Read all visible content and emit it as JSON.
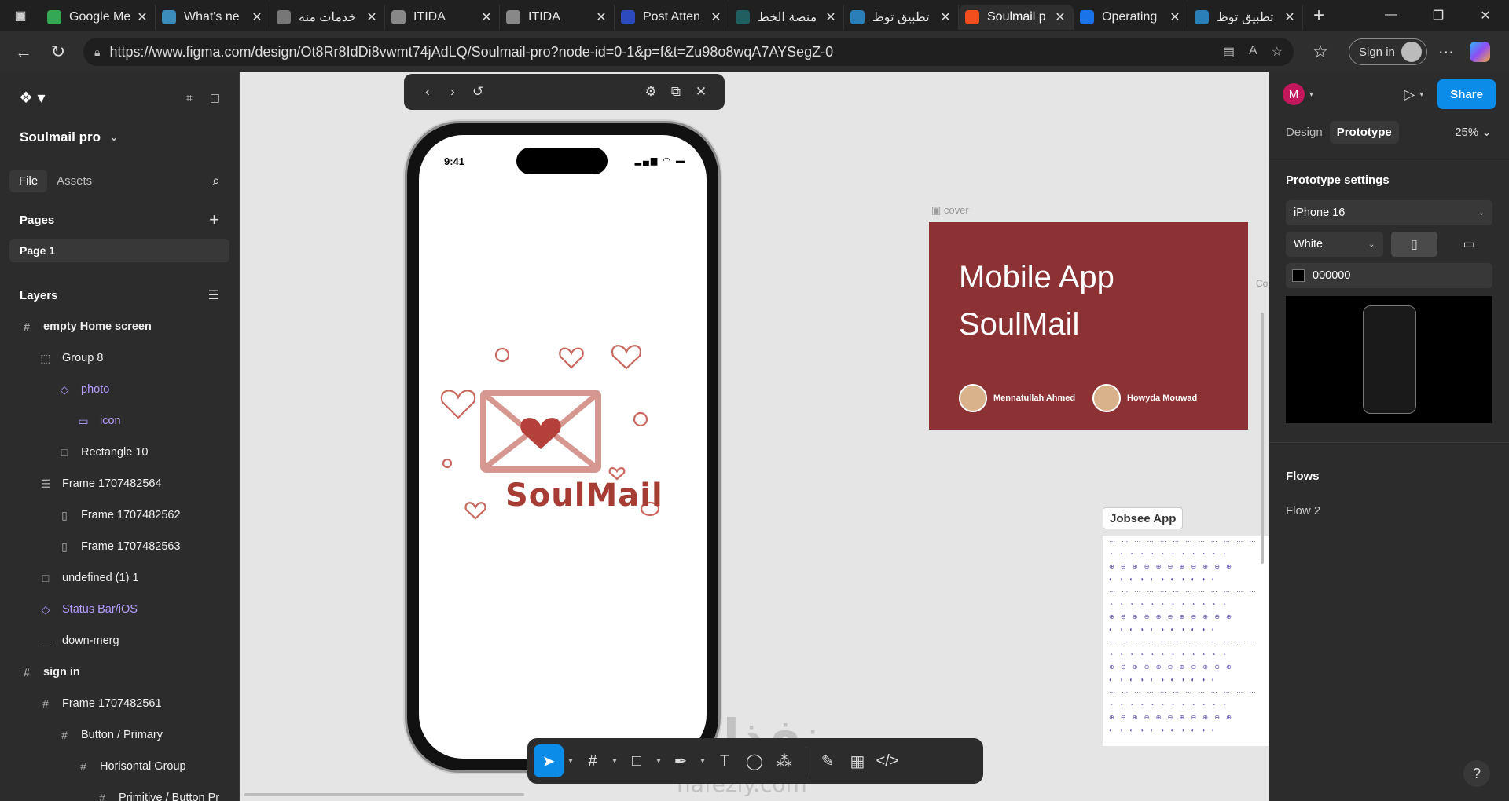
{
  "browser": {
    "tabs": [
      {
        "title": "Google Me",
        "color": "#34a853",
        "active": false
      },
      {
        "title": "What's ne",
        "color": "#3c8dbc",
        "active": false
      },
      {
        "title": "خدمات منه",
        "color": "#777777",
        "active": false
      },
      {
        "title": "ITIDA",
        "color": "#888888",
        "active": false
      },
      {
        "title": "ITIDA",
        "color": "#888888",
        "active": false
      },
      {
        "title": "Post Atten",
        "color": "#2d4bbf",
        "active": false
      },
      {
        "title": "منصة الخط",
        "color": "#1f5f5f",
        "active": false
      },
      {
        "title": "تطبيق توظ",
        "color": "#2a7fb8",
        "active": false
      },
      {
        "title": "Soulmail p",
        "color": "#f24e1e",
        "active": true
      },
      {
        "title": "Operating",
        "color": "#1a73e8",
        "active": false
      },
      {
        "title": "تطبيق توظ",
        "color": "#2a7fb8",
        "active": false
      }
    ],
    "url": "https://www.figma.com/design/Ot8Rr8IdDi8vwmt74jAdLQ/Soulmail-pro?node-id=0-1&p=f&t=Zu98o8wqA7AYSegZ-0",
    "signin_label": "Sign in"
  },
  "left_panel": {
    "project_name": "Soulmail pro",
    "tabs": {
      "file": "File",
      "assets": "Assets"
    },
    "pages_title": "Pages",
    "page1": "Page 1",
    "layers_title": "Layers",
    "layers": [
      {
        "name": "empty Home screen",
        "indent": 0,
        "icon": "#",
        "bold": true,
        "component": false
      },
      {
        "name": "Group 8",
        "indent": 1,
        "icon": "⬚",
        "bold": false,
        "component": false
      },
      {
        "name": "photo",
        "indent": 2,
        "icon": "◇",
        "bold": false,
        "component": true
      },
      {
        "name": "icon",
        "indent": 3,
        "icon": "▭",
        "bold": false,
        "component": true
      },
      {
        "name": "Rectangle 10",
        "indent": 2,
        "icon": "□",
        "bold": false,
        "component": false
      },
      {
        "name": "Frame 1707482564",
        "indent": 1,
        "icon": "☰",
        "bold": false,
        "component": false
      },
      {
        "name": "Frame 1707482562",
        "indent": 2,
        "icon": "▯",
        "bold": false,
        "component": false
      },
      {
        "name": "Frame 1707482563",
        "indent": 2,
        "icon": "▯",
        "bold": false,
        "component": false
      },
      {
        "name": "undefined (1) 1",
        "indent": 1,
        "icon": "□",
        "bold": false,
        "component": false
      },
      {
        "name": "Status Bar/iOS",
        "indent": 1,
        "icon": "◇",
        "bold": false,
        "component": true
      },
      {
        "name": "down-merg",
        "indent": 1,
        "icon": "—",
        "bold": false,
        "component": false
      },
      {
        "name": "sign in",
        "indent": 0,
        "icon": "#",
        "bold": true,
        "component": false
      },
      {
        "name": "Frame 1707482561",
        "indent": 1,
        "icon": "#",
        "bold": false,
        "component": false
      },
      {
        "name": "Button / Primary",
        "indent": 2,
        "icon": "#",
        "bold": false,
        "component": false
      },
      {
        "name": "Horisontal Group",
        "indent": 3,
        "icon": "#",
        "bold": false,
        "component": false
      },
      {
        "name": "Primitive / Button Pr",
        "indent": 4,
        "icon": "#",
        "bold": false,
        "component": false
      }
    ]
  },
  "canvas": {
    "phone_time": "9:41",
    "app_logo_text": "SoulMail",
    "cover_label": "cover",
    "cover_title_1": "Mobile App",
    "cover_title_2": "SoulMail",
    "author1": "Mennatullah Ahmed",
    "author2": "Howyda Mouwad",
    "jobsee_label": "Jobsee App",
    "clipped_label": "Co",
    "watermark": "نفذلي",
    "watermark_sub": "nafezly.com",
    "cover_color": "#8c3134",
    "logo_color": "#a63c34"
  },
  "right_panel": {
    "avatar_letter": "M",
    "share_label": "Share",
    "tabs": {
      "design": "Design",
      "prototype": "Prototype"
    },
    "zoom": "25%",
    "prototype_settings_title": "Prototype settings",
    "device": "iPhone 16",
    "device_color": "White",
    "background_hex": "000000",
    "flows_title": "Flows",
    "flows": [
      "Flow 2"
    ],
    "accent": "#0c8ce9"
  }
}
